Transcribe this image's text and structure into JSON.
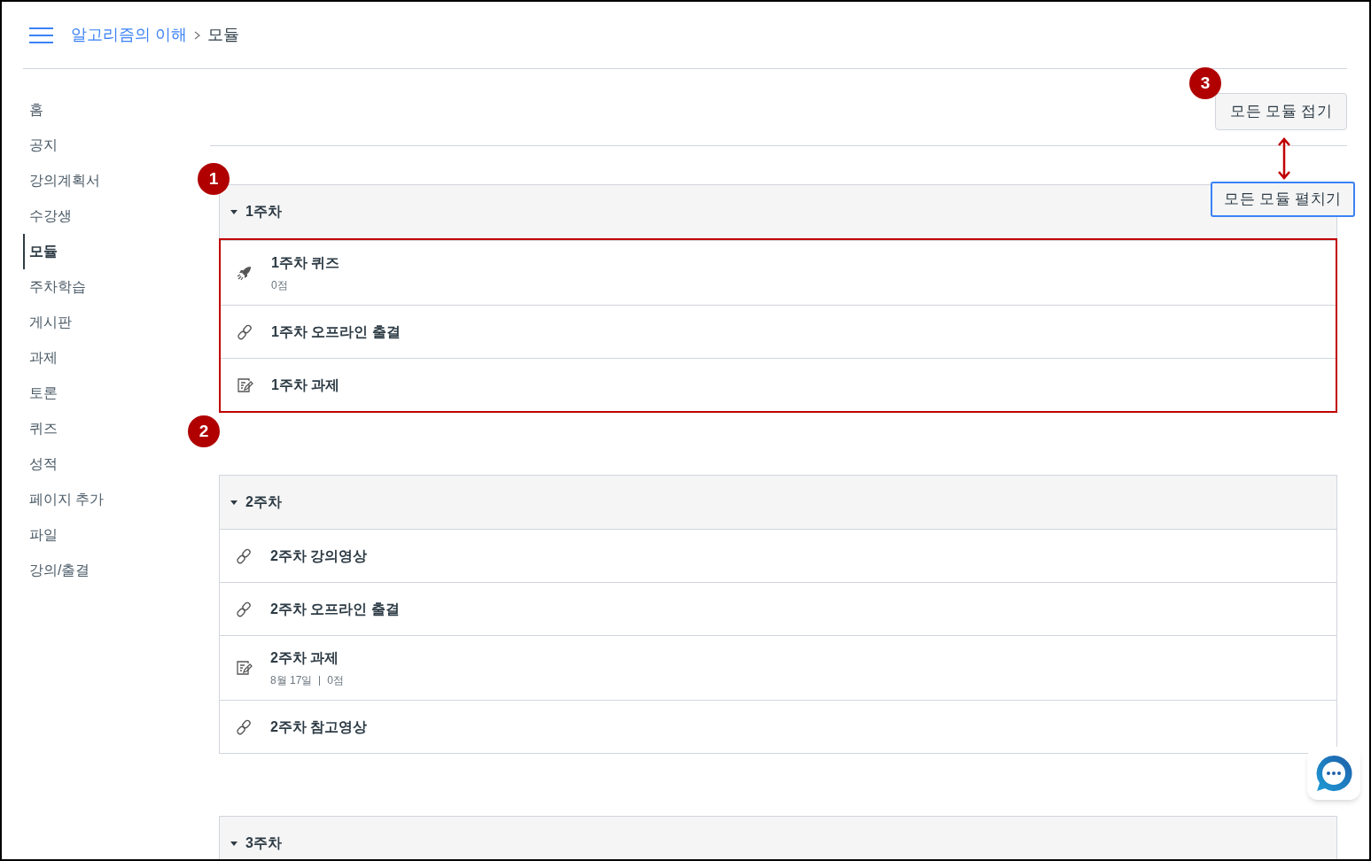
{
  "breadcrumb": {
    "course": "알고리즘의 이해",
    "current": "모듈"
  },
  "sidebar": {
    "items": [
      {
        "label": "홈",
        "selected": false
      },
      {
        "label": "공지",
        "selected": false
      },
      {
        "label": "강의계획서",
        "selected": false
      },
      {
        "label": "수강생",
        "selected": false
      },
      {
        "label": "모듈",
        "selected": true
      },
      {
        "label": "주차학습",
        "selected": false
      },
      {
        "label": "게시판",
        "selected": false
      },
      {
        "label": "과제",
        "selected": false
      },
      {
        "label": "토론",
        "selected": false
      },
      {
        "label": "퀴즈",
        "selected": false
      },
      {
        "label": "성적",
        "selected": false
      },
      {
        "label": "페이지 추가",
        "selected": false
      },
      {
        "label": "파일",
        "selected": false
      },
      {
        "label": "강의/출결",
        "selected": false
      }
    ]
  },
  "collapse_button": "모든 모듈 접기",
  "modules": [
    {
      "title": "1주차",
      "expanded": true,
      "highlighted": true,
      "items": [
        {
          "kind": "quiz",
          "title": "1주차 퀴즈",
          "meta": [
            "0점"
          ]
        },
        {
          "kind": "link",
          "title": "1주차 오프라인 출결"
        },
        {
          "kind": "assignment",
          "title": "1주차 과제"
        }
      ]
    },
    {
      "title": "2주차",
      "expanded": true,
      "items": [
        {
          "kind": "link",
          "title": "2주차 강의영상"
        },
        {
          "kind": "link",
          "title": "2주차 오프라인 출결"
        },
        {
          "kind": "assignment",
          "title": "2주차 과제",
          "meta": [
            "8월 17일",
            "0점"
          ]
        },
        {
          "kind": "link",
          "title": "2주차 참고영상"
        }
      ]
    },
    {
      "title": "3주차",
      "expanded": true
    }
  ],
  "annotations": {
    "callouts": [
      "1",
      "2",
      "3"
    ],
    "expand_button": "모든 모듈 펼치기"
  }
}
